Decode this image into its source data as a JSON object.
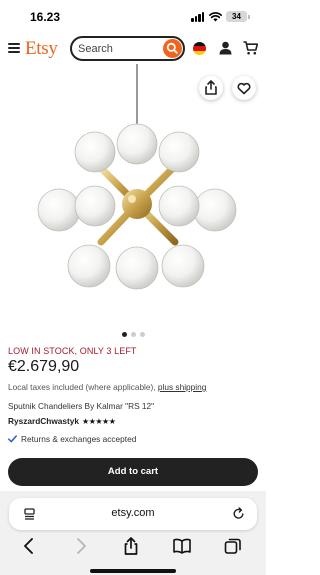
{
  "status_bar": {
    "time": "16.23",
    "battery": "34"
  },
  "header": {
    "logo": "Etsy",
    "search_placeholder": "Search"
  },
  "gallery": {
    "image_count": 3,
    "active_index": 0
  },
  "product": {
    "stock_notice": "LOW IN STOCK, ONLY 3 LEFT",
    "price": "€2.679,90",
    "tax_note": "Local taxes included (where applicable),",
    "shipping_link": "plus shipping",
    "title": "Sputnik Chandeliers By Kalmar \"RS 12\"",
    "seller": "RyszardChwastyk",
    "rating_stars": "★★★★★",
    "returns": "Returns & exchanges accepted",
    "add_to_cart": "Add to cart"
  },
  "safari": {
    "url": "etsy.com"
  },
  "colors": {
    "brand": "#f1641e",
    "stock_red": "#a61a2e",
    "button_dark": "#222222"
  }
}
